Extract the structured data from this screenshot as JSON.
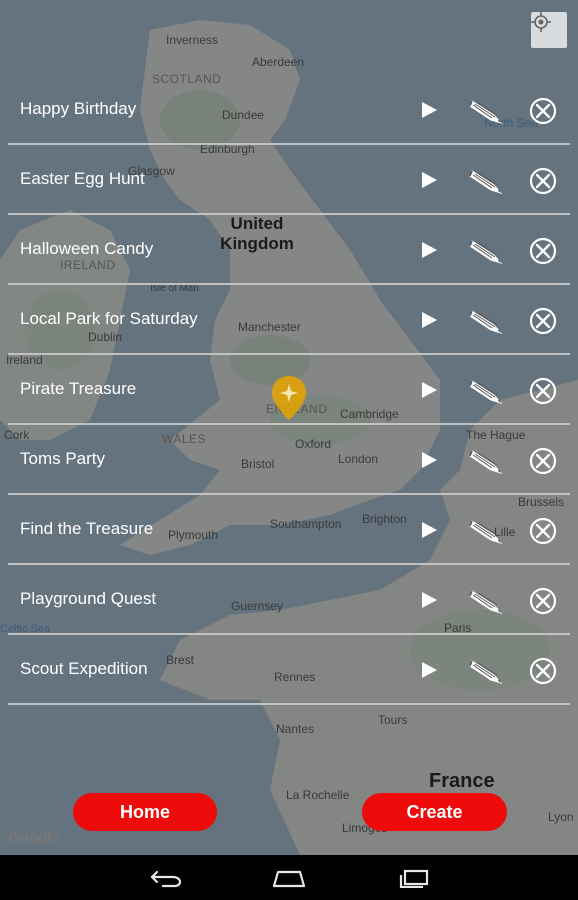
{
  "map": {
    "labels": {
      "inverness": "Inverness",
      "aberdeen": "Aberdeen",
      "scotland": "SCOTLAND",
      "dundee": "Dundee",
      "north_sea": "North Sea",
      "edinburgh": "Edinburgh",
      "glasgow": "Glasgow",
      "united_kingdom": "United Kingdom",
      "ireland_region": "IRELAND",
      "isle_of_man": "Isle of Man",
      "manchester": "Manchester",
      "dublin": "Dublin",
      "ireland": "Ireland",
      "england": "ENGLAND",
      "cambridge": "Cambridge",
      "wales": "WALES",
      "oxford": "Oxford",
      "cork": "Cork",
      "the_hague": "The Hague",
      "bristol": "Bristol",
      "london": "London",
      "brussels": "Brussels",
      "lille": "Lille",
      "southampton": "Southampton",
      "brighton": "Brighton",
      "plymouth": "Plymouth",
      "guernsey": "Guernsey",
      "celtic_sea": "Celtic Sea",
      "paris": "Paris",
      "brest": "Brest",
      "rennes": "Rennes",
      "nantes": "Nantes",
      "tours": "Tours",
      "france": "France",
      "la_rochelle": "La Rochelle",
      "limoges": "Limoges",
      "lyon": "Lyon",
      "google": "Google"
    }
  },
  "quests": [
    {
      "name": "Happy Birthday"
    },
    {
      "name": "Easter Egg Hunt"
    },
    {
      "name": "Halloween Candy"
    },
    {
      "name": "Local Park for Saturday"
    },
    {
      "name": "Pirate Treasure"
    },
    {
      "name": "Toms Party"
    },
    {
      "name": "Find the Treasure"
    },
    {
      "name": "Playground Quest"
    },
    {
      "name": "Scout Expedition"
    }
  ],
  "buttons": {
    "home": "Home",
    "create": "Create"
  },
  "colors": {
    "accent": "#ee0b0b",
    "pin": "#e8a400"
  },
  "icons": {
    "play": "play-icon",
    "edit": "pencil-icon",
    "delete": "close-circle-icon",
    "locate": "my-location-icon",
    "pin": "map-pin-icon",
    "nav_back": "back-icon",
    "nav_home": "home-icon",
    "nav_recents": "recents-icon"
  }
}
